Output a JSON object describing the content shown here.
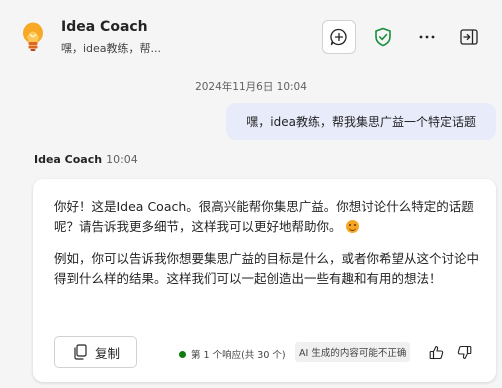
{
  "header": {
    "title": "Idea Coach",
    "subtitle": "嘿，idea教练，帮..."
  },
  "icons": {
    "avatar": "lightbulb-icon",
    "new_chat": "chat-add-icon",
    "shield": "shield-check-icon",
    "more": "more-icon",
    "collapse": "panel-exit-icon"
  },
  "conversation": {
    "date_time": "2024年11月6日 10:04",
    "user_message": "嘿，idea教练，帮我集思广益一个特定话题",
    "bot_name": "Idea Coach",
    "bot_time": "10:04",
    "response_p1": "你好！这是Idea Coach。很高兴能帮你集思广益。你想讨论什么特定的话题呢？请告诉我更多细节，这样我可以更好地帮助你。",
    "response_p2": "例如，你可以告诉我你想要集思广益的目标是什么，或者你希望从这个讨论中得到什么样的结果。这样我们可以一起创造出一些有趣和有用的想法！"
  },
  "footer": {
    "copy_label": "复制",
    "response_count": "第 1 个响应(共 30 个)",
    "ai_disclaimer": "AI 生成的内容可能不正确"
  },
  "colors": {
    "accent": "#1a8f3c",
    "user_bubble": "#e8ebfa",
    "lightbulb": "#f7a825"
  }
}
